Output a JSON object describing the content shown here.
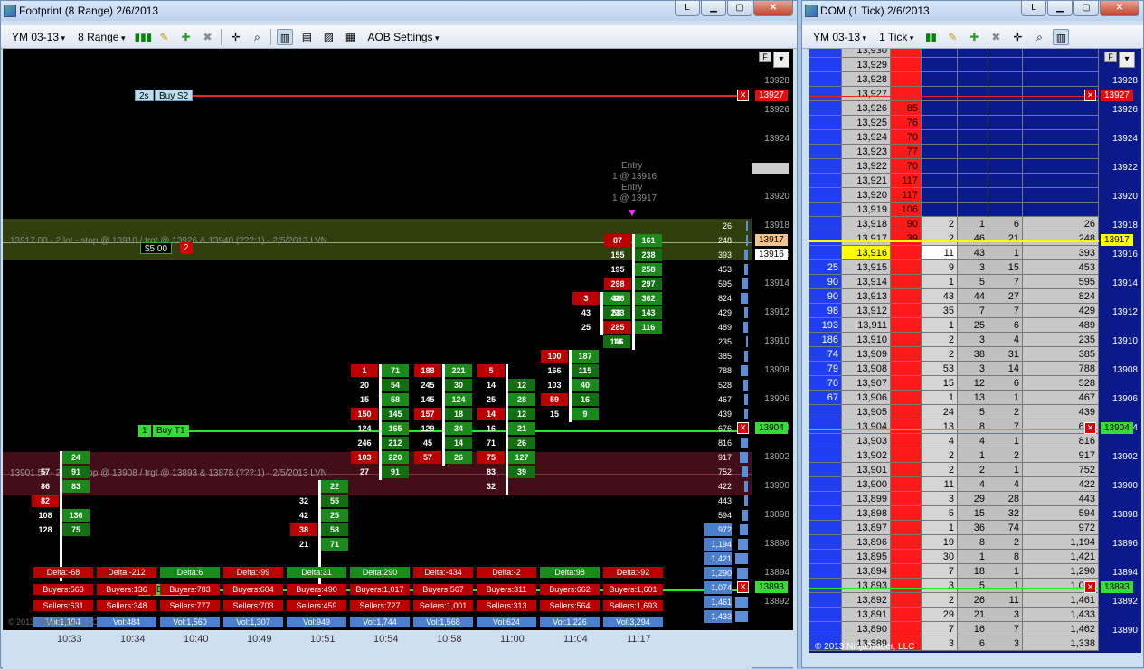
{
  "left_window": {
    "title": "Footprint (8 Range)  2/6/2013",
    "toolbar": {
      "instrument": "YM 03-13",
      "period": "8 Range",
      "aob": "AOB Settings"
    },
    "price_labels": [
      "13928",
      "13926",
      "13924",
      "13922",
      "13920",
      "13918",
      "13916",
      "13914",
      "13912",
      "13910",
      "13908",
      "13906",
      "13904",
      "13902",
      "13900",
      "13898",
      "13896",
      "13894",
      "13892"
    ],
    "time_labels": [
      "10:33",
      "10:34",
      "10:40",
      "10:49",
      "10:51",
      "10:54",
      "10:58",
      "11:00",
      "11:04",
      "11:17"
    ],
    "orders": {
      "buy_s2": {
        "qty": "2s",
        "label": "Buy S2",
        "price": "13927"
      },
      "buy_t1": {
        "qty": "1",
        "label": "Buy T1",
        "price": "13904"
      },
      "buy_t2": {
        "qty": "1",
        "label": "Buy T2",
        "price": "13893"
      },
      "current": "13917",
      "current2": "13916"
    },
    "pos1": {
      "text": "13917.00 - 2 lot - stop @ 13910 / trgt @ 13926 & 13940 (???:1) - 2/5/2013 LVN",
      "pnl": "$5.00",
      "qty": "2"
    },
    "pos2": {
      "text": "13901.57 - 2 lot - stop @ 13908 / trgt @ 13893 & 13878 (???:1) - 2/5/2013 LVN"
    },
    "entry": {
      "l1": "Entry",
      "l2": "1 @ 13916",
      "l3": "Entry",
      "l4": "1 @ 13917"
    },
    "stats": [
      {
        "delta": "Delta:-68",
        "buyers": "Buyers:563",
        "sellers": "Sellers:631",
        "vol": "Vol:1,194"
      },
      {
        "delta": "Delta:-212",
        "buyers": "Buyers:136",
        "sellers": "Sellers:348",
        "vol": "Vol:484"
      },
      {
        "delta": "Delta:6",
        "buyers": "Buyers:783",
        "sellers": "Sellers:777",
        "vol": "Vol:1,560"
      },
      {
        "delta": "Delta:-99",
        "buyers": "Buyers:604",
        "sellers": "Sellers:703",
        "vol": "Vol:1,307"
      },
      {
        "delta": "Delta:31",
        "buyers": "Buyers:490",
        "sellers": "Sellers:459",
        "vol": "Vol:949"
      },
      {
        "delta": "Delta:290",
        "buyers": "Buyers:1,017",
        "sellers": "Sellers:727",
        "vol": "Vol:1,744"
      },
      {
        "delta": "Delta:-434",
        "buyers": "Buyers:567",
        "sellers": "Sellers:1,001",
        "vol": "Vol:1,568"
      },
      {
        "delta": "Delta:-2",
        "buyers": "Buyers:311",
        "sellers": "Sellers:313",
        "vol": "Vol:624"
      },
      {
        "delta": "Delta:98",
        "buyers": "Buyers:662",
        "sellers": "Sellers:564",
        "vol": "Vol:1,226"
      },
      {
        "delta": "Delta:-92",
        "buyers": "Buyers:1,601",
        "sellers": "Sellers:1,693",
        "vol": "Vol:3,294"
      }
    ],
    "volume_profile": [
      "26",
      "248",
      "393",
      "453",
      "595",
      "824",
      "429",
      "489",
      "235",
      "385",
      "788",
      "528",
      "467",
      "439",
      "676",
      "816",
      "917",
      "752",
      "422",
      "443",
      "594",
      "972",
      "1,194",
      "1,421",
      "1,290",
      "1,074",
      "1,461",
      "1,433"
    ],
    "copyright": "© 2013 NinjaTrader, LLC"
  },
  "right_window": {
    "title": "DOM (1 Tick)  2/6/2013",
    "toolbar": {
      "instrument": "YM 03-13",
      "period": "1 Tick"
    },
    "price_labels": [
      "13928",
      "13926",
      "13924",
      "13922",
      "13920",
      "13918",
      "13916",
      "13914",
      "13912",
      "13910",
      "13908",
      "13906",
      "13904",
      "13902",
      "13900",
      "13898",
      "13896",
      "13894",
      "13892",
      "13890"
    ],
    "rows": [
      {
        "b": "",
        "p": "13,930",
        "a": "",
        "c1": "",
        "c2": "",
        "c3": "",
        "v": ""
      },
      {
        "b": "",
        "p": "13,929",
        "a": "",
        "c1": "",
        "c2": "",
        "c3": "",
        "v": ""
      },
      {
        "b": "",
        "p": "13,928",
        "a": "",
        "c1": "",
        "c2": "",
        "c3": "",
        "v": ""
      },
      {
        "b": "",
        "p": "13,927",
        "a": "",
        "c1": "",
        "c2": "",
        "c3": "",
        "v": ""
      },
      {
        "b": "",
        "p": "13,926",
        "a": "85",
        "c1": "",
        "c2": "",
        "c3": "",
        "v": ""
      },
      {
        "b": "",
        "p": "13,925",
        "a": "76",
        "c1": "",
        "c2": "",
        "c3": "",
        "v": ""
      },
      {
        "b": "",
        "p": "13,924",
        "a": "70",
        "c1": "",
        "c2": "",
        "c3": "",
        "v": ""
      },
      {
        "b": "",
        "p": "13,923",
        "a": "77",
        "c1": "",
        "c2": "",
        "c3": "",
        "v": ""
      },
      {
        "b": "",
        "p": "13,922",
        "a": "70",
        "c1": "",
        "c2": "",
        "c3": "",
        "v": ""
      },
      {
        "b": "",
        "p": "13,921",
        "a": "117",
        "c1": "",
        "c2": "",
        "c3": "",
        "v": ""
      },
      {
        "b": "",
        "p": "13,920",
        "a": "117",
        "c1": "",
        "c2": "",
        "c3": "",
        "v": ""
      },
      {
        "b": "",
        "p": "13,919",
        "a": "106",
        "c1": "",
        "c2": "",
        "c3": "",
        "v": ""
      },
      {
        "b": "",
        "p": "13,918",
        "a": "90",
        "c1": "2",
        "c2": "1",
        "c3": "6",
        "v": "26"
      },
      {
        "b": "",
        "p": "13,917",
        "a": "39",
        "c1": "2",
        "c2": "46",
        "c3": "21",
        "v": "248"
      },
      {
        "b": "",
        "p": "13,916",
        "a": "",
        "c1": "11",
        "c2": "43",
        "c3": "1",
        "v": "393"
      },
      {
        "b": "25",
        "p": "13,915",
        "a": "",
        "c1": "9",
        "c2": "3",
        "c3": "15",
        "v": "453"
      },
      {
        "b": "90",
        "p": "13,914",
        "a": "",
        "c1": "1",
        "c2": "5",
        "c3": "7",
        "v": "595"
      },
      {
        "b": "90",
        "p": "13,913",
        "a": "",
        "c1": "43",
        "c2": "44",
        "c3": "27",
        "v": "824"
      },
      {
        "b": "98",
        "p": "13,912",
        "a": "",
        "c1": "35",
        "c2": "7",
        "c3": "7",
        "v": "429"
      },
      {
        "b": "193",
        "p": "13,911",
        "a": "",
        "c1": "1",
        "c2": "25",
        "c3": "6",
        "v": "489"
      },
      {
        "b": "186",
        "p": "13,910",
        "a": "",
        "c1": "2",
        "c2": "3",
        "c3": "4",
        "v": "235"
      },
      {
        "b": "74",
        "p": "13,909",
        "a": "",
        "c1": "2",
        "c2": "38",
        "c3": "31",
        "v": "385"
      },
      {
        "b": "79",
        "p": "13,908",
        "a": "",
        "c1": "53",
        "c2": "3",
        "c3": "14",
        "v": "788"
      },
      {
        "b": "70",
        "p": "13,907",
        "a": "",
        "c1": "15",
        "c2": "12",
        "c3": "6",
        "v": "528"
      },
      {
        "b": "67",
        "p": "13,906",
        "a": "",
        "c1": "1",
        "c2": "13",
        "c3": "1",
        "v": "467"
      },
      {
        "b": "",
        "p": "13,905",
        "a": "",
        "c1": "24",
        "c2": "5",
        "c3": "2",
        "v": "439"
      },
      {
        "b": "",
        "p": "13,904",
        "a": "",
        "c1": "13",
        "c2": "8",
        "c3": "7",
        "v": "676"
      },
      {
        "b": "",
        "p": "13,903",
        "a": "",
        "c1": "4",
        "c2": "4",
        "c3": "1",
        "v": "816"
      },
      {
        "b": "",
        "p": "13,902",
        "a": "",
        "c1": "2",
        "c2": "1",
        "c3": "2",
        "v": "917"
      },
      {
        "b": "",
        "p": "13,901",
        "a": "",
        "c1": "2",
        "c2": "2",
        "c3": "1",
        "v": "752"
      },
      {
        "b": "",
        "p": "13,900",
        "a": "",
        "c1": "11",
        "c2": "4",
        "c3": "4",
        "v": "422"
      },
      {
        "b": "",
        "p": "13,899",
        "a": "",
        "c1": "3",
        "c2": "29",
        "c3": "28",
        "v": "443"
      },
      {
        "b": "",
        "p": "13,898",
        "a": "",
        "c1": "5",
        "c2": "15",
        "c3": "32",
        "v": "594"
      },
      {
        "b": "",
        "p": "13,897",
        "a": "",
        "c1": "1",
        "c2": "36",
        "c3": "74",
        "v": "972"
      },
      {
        "b": "",
        "p": "13,896",
        "a": "",
        "c1": "19",
        "c2": "8",
        "c3": "2",
        "v": "1,194"
      },
      {
        "b": "",
        "p": "13,895",
        "a": "",
        "c1": "30",
        "c2": "1",
        "c3": "8",
        "v": "1,421"
      },
      {
        "b": "",
        "p": "13,894",
        "a": "",
        "c1": "7",
        "c2": "18",
        "c3": "1",
        "v": "1,290"
      },
      {
        "b": "",
        "p": "13,893",
        "a": "",
        "c1": "3",
        "c2": "5",
        "c3": "1",
        "v": "1,074"
      },
      {
        "b": "",
        "p": "13,892",
        "a": "",
        "c1": "2",
        "c2": "26",
        "c3": "11",
        "v": "1,461"
      },
      {
        "b": "",
        "p": "13,891",
        "a": "",
        "c1": "29",
        "c2": "21",
        "c3": "3",
        "v": "1,433"
      },
      {
        "b": "",
        "p": "13,890",
        "a": "",
        "c1": "7",
        "c2": "16",
        "c3": "7",
        "v": "1,462"
      },
      {
        "b": "",
        "p": "13,889",
        "a": "",
        "c1": "3",
        "c2": "6",
        "c3": "3",
        "v": "1,338"
      }
    ],
    "orders": {
      "top": "13927",
      "t1": "13904",
      "t2": "13893",
      "current": "13917"
    },
    "copyright": "© 2013 NinjaTrader, LLC"
  }
}
